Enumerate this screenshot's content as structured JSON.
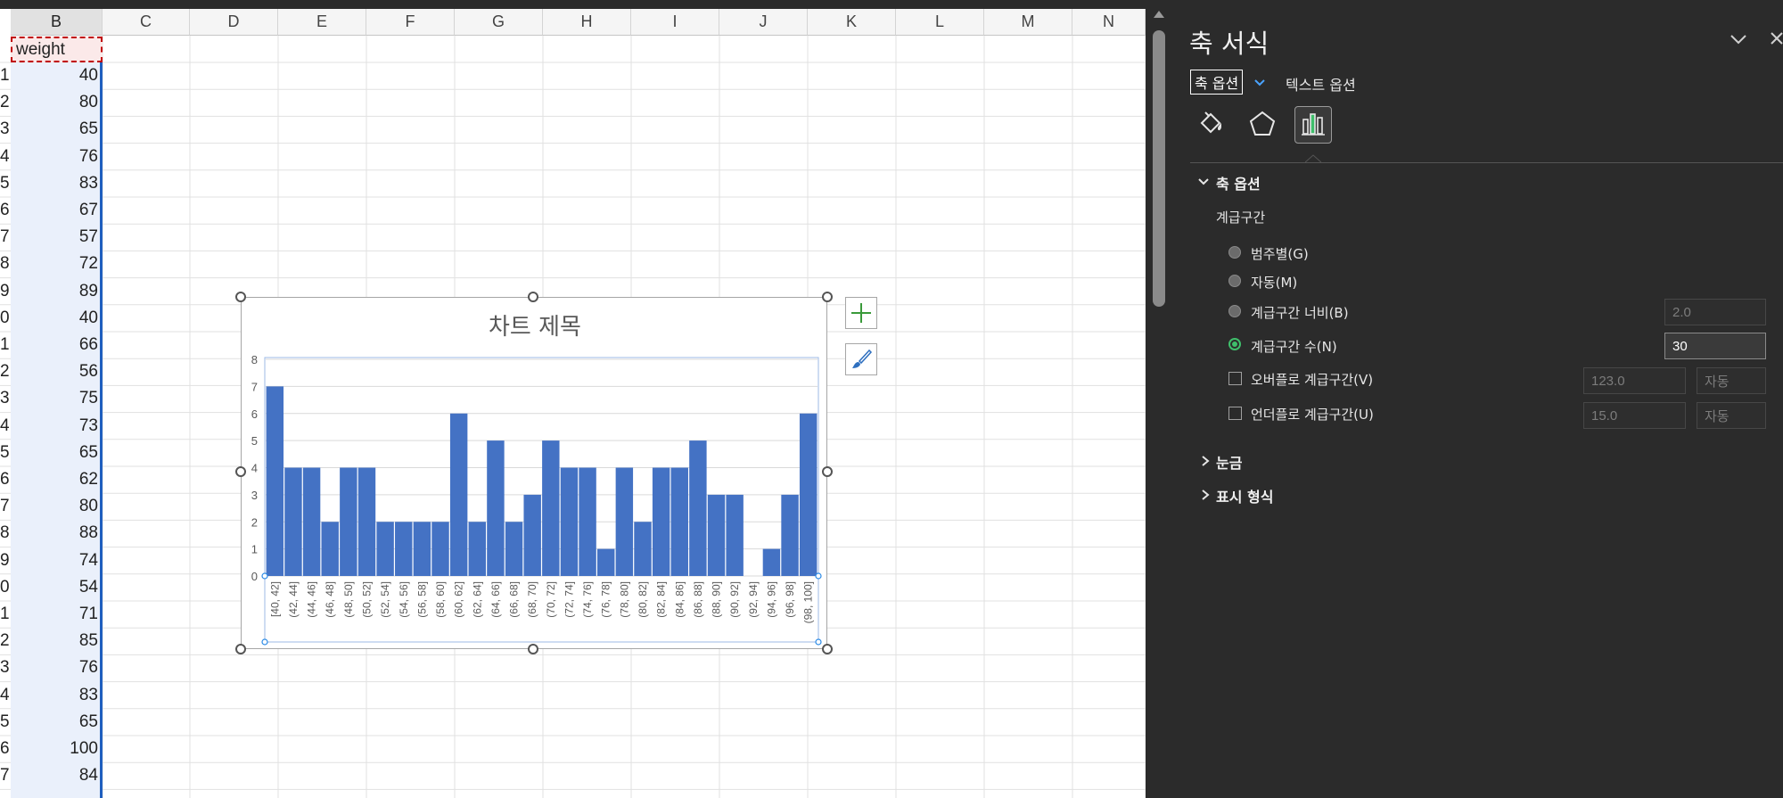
{
  "spreadsheet": {
    "column_headers": [
      "B",
      "C",
      "D",
      "E",
      "F",
      "G",
      "H",
      "I",
      "J",
      "K",
      "L",
      "M",
      "N"
    ],
    "header_cell": "weight",
    "row_numbers": [
      "1",
      "2",
      "3",
      "4",
      "5",
      "6",
      "7",
      "8",
      "9",
      "0",
      "1",
      "2",
      "3",
      "4",
      "5",
      "6",
      "7",
      "8",
      "9",
      "0",
      "1",
      "2",
      "3",
      "4",
      "5",
      "6",
      "7"
    ],
    "values": [
      "40",
      "80",
      "65",
      "76",
      "83",
      "67",
      "57",
      "72",
      "89",
      "40",
      "66",
      "56",
      "75",
      "73",
      "65",
      "62",
      "80",
      "88",
      "74",
      "54",
      "71",
      "85",
      "76",
      "83",
      "65",
      "100",
      "84"
    ]
  },
  "chart": {
    "plus_icon": "plus-icon",
    "brush_icon": "brush-icon"
  },
  "chart_data": {
    "type": "bar",
    "title": "차트 제목",
    "xlabel": "",
    "ylabel": "",
    "ylim": [
      0,
      8
    ],
    "yticks": [
      "0",
      "1",
      "2",
      "3",
      "4",
      "5",
      "6",
      "7",
      "8"
    ],
    "categories": [
      "[40, 42]",
      "(42, 44]",
      "(44, 46]",
      "(46, 48]",
      "(48, 50]",
      "(50, 52]",
      "(52, 54]",
      "(54, 56]",
      "(56, 58]",
      "(58, 60]",
      "(60, 62]",
      "(62, 64]",
      "(64, 66]",
      "(66, 68]",
      "(68, 70]",
      "(70, 72]",
      "(72, 74]",
      "(74, 76]",
      "(76, 78]",
      "(78, 80]",
      "(80, 82]",
      "(82, 84]",
      "(84, 86]",
      "(86, 88]",
      "(88, 90]",
      "(90, 92]",
      "(92, 94]",
      "(94, 96]",
      "(96, 98]",
      "(98, 100]"
    ],
    "values": [
      7,
      4,
      4,
      2,
      4,
      4,
      2,
      2,
      2,
      2,
      6,
      2,
      5,
      2,
      3,
      5,
      4,
      4,
      1,
      4,
      2,
      4,
      4,
      5,
      3,
      3,
      0,
      1,
      3,
      6
    ],
    "bar_color": "#4472c4",
    "grid": true
  },
  "pane": {
    "title": "축 서식",
    "tab_axis_options": "축 옵션",
    "tab_text_options": "텍스트 옵션",
    "icons": [
      "fill-line-icon",
      "effects-pentagon-icon",
      "axis-options-bars-icon"
    ],
    "section_axis_options": "축 옵션",
    "bins_label": "계급구간",
    "radio_by_category": "범주별(G)",
    "radio_auto": "자동(M)",
    "radio_bin_width": "계급구간 너비(B)",
    "radio_bin_count": "계급구간 수(N)",
    "bin_width_value": "2.0",
    "bin_count_value": "30",
    "overflow_label": "오버플로 계급구간(V)",
    "overflow_value": "123.0",
    "overflow_auto": "자동",
    "underflow_label": "언더플로 계급구간(U)",
    "underflow_value": "15.0",
    "underflow_auto": "자동",
    "section_ticks": "눈금",
    "section_number": "표시 형식",
    "accent_color": "#3fbf6b"
  }
}
